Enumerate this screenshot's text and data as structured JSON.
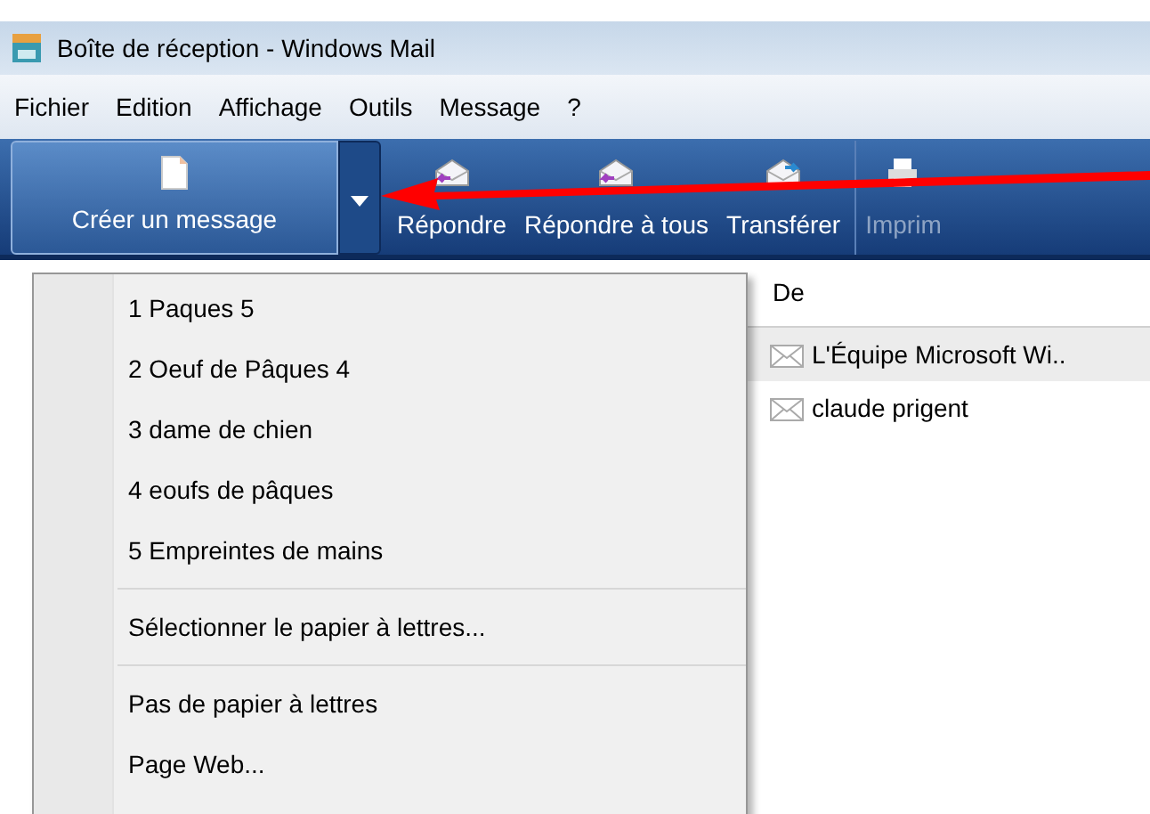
{
  "window": {
    "title": "Boîte de réception - Windows Mail"
  },
  "menu_bar": [
    "Fichier",
    "Edition",
    "Affichage",
    "Outils",
    "Message",
    "?"
  ],
  "toolbar": [
    {
      "label": "Créer un message",
      "kind": "split",
      "disabled": false
    },
    {
      "label": "Répondre",
      "kind": "reply",
      "disabled": false
    },
    {
      "label": "Répondre à tous",
      "kind": "reply-all",
      "disabled": false
    },
    {
      "label": "Transférer",
      "kind": "forward",
      "disabled": false
    },
    {
      "label": "Imprim",
      "kind": "print",
      "disabled": true
    }
  ],
  "dropdown_menu": {
    "groups": [
      [
        "1 Paques 5",
        "2 Oeuf de Pâques 4",
        "3 dame de chien",
        "4 eoufs de pâques",
        "5 Empreintes de mains"
      ],
      [
        "Sélectionner le papier à lettres..."
      ],
      [
        "Pas de papier à lettres",
        "Page Web..."
      ]
    ]
  },
  "message_list": {
    "columns": [
      "De"
    ],
    "rows": [
      {
        "from": "L'Équipe Microsoft Wi..",
        "selected": true
      },
      {
        "from": "claude prigent",
        "selected": false
      }
    ]
  }
}
